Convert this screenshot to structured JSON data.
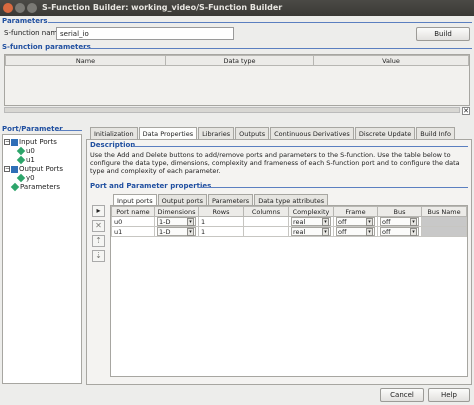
{
  "window": {
    "title": "S-Function Builder: working_video/S-Function Builder"
  },
  "parameters_group": {
    "label": "Parameters",
    "sfunction_name_label": "S-function name:",
    "sfunction_name_value": "serial_io",
    "build_label": "Build"
  },
  "sfunction_params": {
    "label": "S-function parameters",
    "columns": [
      "Name",
      "Data type",
      "Value"
    ]
  },
  "port_parameter": {
    "label": "Port/Parameter",
    "tree": {
      "input_ports": "Input Ports",
      "inputs": [
        "u0",
        "u1"
      ],
      "output_ports": "Output Ports",
      "outputs": [
        "y0"
      ],
      "parameters": "Parameters"
    }
  },
  "tabs": [
    {
      "label": "Initialization",
      "active": false
    },
    {
      "label": "Data Properties",
      "active": true
    },
    {
      "label": "Libraries",
      "active": false
    },
    {
      "label": "Outputs",
      "active": false
    },
    {
      "label": "Continuous Derivatives",
      "active": false
    },
    {
      "label": "Discrete Update",
      "active": false
    },
    {
      "label": "Build Info",
      "active": false
    }
  ],
  "description": {
    "label": "Description",
    "text": "Use the Add and Delete buttons to add/remove ports and parameters to the S-function. Use the table below to configure the data type, dimensions, complexity and frameness of each S-function port and to configure the data type and complexity of each parameter."
  },
  "port_props": {
    "label": "Port and Parameter properties",
    "subtabs": [
      "Input ports",
      "Output ports",
      "Parameters",
      "Data type attributes"
    ],
    "columns": [
      "Port name",
      "Dimensions",
      "Rows",
      "Columns",
      "Complexity",
      "Frame",
      "Bus",
      "Bus Name"
    ],
    "rows": [
      {
        "port": "u0",
        "dims": "1-D",
        "rows": "1",
        "cols": "",
        "complexity": "real",
        "frame": "off",
        "bus": "off",
        "busname": ""
      },
      {
        "port": "u1",
        "dims": "1-D",
        "rows": "1",
        "cols": "",
        "complexity": "real",
        "frame": "off",
        "bus": "off",
        "busname": ""
      }
    ]
  },
  "footer": {
    "cancel": "Cancel",
    "help": "Help"
  }
}
